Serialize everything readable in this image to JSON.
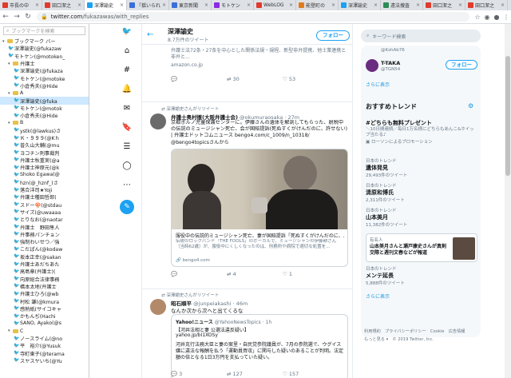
{
  "tabs": [
    {
      "label": "市長の中",
      "color": "#e03b2e"
    },
    {
      "label": "田口潔之",
      "color": "#e03b2e"
    },
    {
      "label": "深澤諭史",
      "color": "#1da1f2",
      "active": true
    },
    {
      "label": "『揺いられ",
      "color": "#3a6fd8"
    },
    {
      "label": "東京新聞",
      "color": "#3a6fd8"
    },
    {
      "label": "モトケン",
      "color": "#8a2be2"
    },
    {
      "label": "WebLOG",
      "color": "#e03b2e"
    },
    {
      "label": "能登町の",
      "color": "#e07b1d"
    },
    {
      "label": "深澤諭史",
      "color": "#1da1f2"
    },
    {
      "label": "遠法捜査",
      "color": "#2e8b57"
    },
    {
      "label": "田口潔之",
      "color": "#e03b2e"
    },
    {
      "label": "田口潔之",
      "color": "#e03b2e"
    }
  ],
  "address": {
    "host": "twitter.com",
    "path": "/fukazawas/with_replies"
  },
  "bookmarks": {
    "search_placeholder": "ブックマークを検索",
    "items": [
      {
        "label": "ブックマーク バー",
        "type": "folder",
        "exp": "▾",
        "indent": 0
      },
      {
        "label": "深澤諭史(@fukazaw",
        "type": "tw",
        "indent": 1
      },
      {
        "label": "モトケン(@motoken_",
        "type": "tw",
        "indent": 1
      },
      {
        "label": "弁護士",
        "type": "folder",
        "exp": "▾",
        "indent": 1
      },
      {
        "label": "深澤諭史(@fukaza",
        "type": "tw",
        "indent": 2
      },
      {
        "label": "モトケン(@motoke",
        "type": "tw",
        "indent": 2
      },
      {
        "label": "小倉秀夫(@Hide",
        "type": "tw",
        "indent": 2
      },
      {
        "label": "A",
        "type": "folder",
        "exp": "▾",
        "indent": 1
      },
      {
        "label": "深澤諭史(@fuka",
        "type": "tw",
        "indent": 2,
        "sel": true
      },
      {
        "label": "モトケン(@motok",
        "type": "tw",
        "indent": 2
      },
      {
        "label": "小倉秀夫(@Hide",
        "type": "tw",
        "indent": 2
      },
      {
        "label": "B",
        "type": "folder",
        "exp": "▾",
        "indent": 1
      },
      {
        "label": "ystk(@lawkus)さ",
        "type": "tw",
        "indent": 2
      },
      {
        "label": "Ｋ・９９９(@Kｈ",
        "type": "tw",
        "indent": 2
      },
      {
        "label": "普久山大輔(@mu",
        "type": "tw",
        "indent": 2
      },
      {
        "label": "ヨコチン刑事裁判",
        "type": "tw",
        "indent": 2
      },
      {
        "label": "弁護士秋重実(@a",
        "type": "tw",
        "indent": 2
      },
      {
        "label": "弁護士神原元(@k",
        "type": "tw",
        "indent": 2
      },
      {
        "label": "Shoko Egawa(@",
        "type": "tw",
        "indent": 2
      },
      {
        "label": "hzn(@_hznf_)さ",
        "type": "tw",
        "indent": 2
      },
      {
        "label": "落合洋司★Yoji",
        "type": "tw",
        "indent": 2
      },
      {
        "label": "弁護士種田哲郎(",
        "type": "tw",
        "indent": 2
      },
      {
        "label": "スドー🍄(@stdau",
        "type": "tw",
        "indent": 2
      },
      {
        "label": "サイズ(@uwaaaa",
        "type": "tw",
        "indent": 2
      },
      {
        "label": "とりなお(@naotar",
        "type": "tw",
        "indent": 2
      },
      {
        "label": "弁護士　野田隼人",
        "type": "tw",
        "indent": 2
      },
      {
        "label": "弁事務パンチョン",
        "type": "tw",
        "indent": 2
      },
      {
        "label": "強制わいせつ／強",
        "type": "tw",
        "indent": 2
      },
      {
        "label": "こだぱん(@kodaw",
        "type": "tw",
        "indent": 2
      },
      {
        "label": "坂本正幸(@sakan",
        "type": "tw",
        "indent": 2
      },
      {
        "label": "弁護士あだちあた",
        "type": "tw",
        "indent": 2
      },
      {
        "label": "高島章(弁護士)(",
        "type": "tw",
        "indent": 2
      },
      {
        "label": "向原総合法律事務",
        "type": "tw",
        "indent": 2
      },
      {
        "label": "橋本太地(弁護士",
        "type": "tw",
        "indent": 2
      },
      {
        "label": "弁護士ひろ(@wb",
        "type": "tw",
        "indent": 2
      },
      {
        "label": "村松 謙(@kmura",
        "type": "tw",
        "indent": 2
      },
      {
        "label": "感熱紙(サイコキャ",
        "type": "tw",
        "indent": 2
      },
      {
        "label": "かもんぢ(Hachi",
        "type": "tw",
        "indent": 2
      },
      {
        "label": "SANO, Ayako(@s",
        "type": "tw",
        "indent": 2
      },
      {
        "label": "C",
        "type": "folder",
        "exp": "▾",
        "indent": 1
      },
      {
        "label": "ノースライム(@no",
        "type": "tw",
        "indent": 2
      },
      {
        "label": "平　裕介(@Yusuk",
        "type": "tw",
        "indent": 2
      },
      {
        "label": "寺町東子(@terama",
        "type": "tw",
        "indent": 2
      },
      {
        "label": "スヤスヤいち(@Yu",
        "type": "tw",
        "indent": 2
      }
    ]
  },
  "leftnav": [
    "twitter-bird-icon",
    "home-icon",
    "hashtag-icon",
    "bell-icon",
    "mail-icon",
    "bookmark-icon",
    "list-icon",
    "profile-icon",
    "more-icon",
    "compose-icon"
  ],
  "header": {
    "name": "深澤諭史",
    "count": "8.7万件のツイート",
    "follow": "フォロー"
  },
  "tweet0": {
    "text": "弁護士法72条・27条を中心とした関係法規・規程、新型非弁提携、他士業連携と非弁と...",
    "domain": "amazon.co.jp",
    "reply": "",
    "rt": "30",
    "like": "53"
  },
  "tweet1": {
    "rt_label": "深澤諭史さんがリツイート",
    "name": "弁護士奥村徹(大阪弁護士会)",
    "handle": "@okumuraosaka · 27m",
    "text": "京都ポルノ児童保護センターに。伊藤さんの遺体を解剖してもらった、脱税中の伝説のミュージシャン死亡、会が国賠提訴(死ぬすくがけんだのに、許せない) | 弁護士ドットコムニュース bengo4.com/c_1009/n_10318/ @bengo4topicsさんから",
    "card_title": "服役中の伝説的ミュージシャン死亡、妻が国賠提訴「死ぬすくがけんだのに、...",
    "card_desc": "伝説のロックバンド「THE FOOLS」のボーカルで、ミュージシャンの伊藤耕さん（当時62歳）が、服役中にくしくなったのは、刑務所や病院で適切な処置を...",
    "card_domain": "bengo4.com",
    "reply": "",
    "rt": "4",
    "like": "1"
  },
  "tweet2": {
    "rt_label": "深澤諭史さんがリツイート",
    "name": "昭石順平",
    "handle": "@junpeiakashi · 46m",
    "text": "なんか次から次へと出てくるな",
    "quote_name": "Yahoo!ニュース",
    "quote_handle": "@YahooNewsTopics · 1h",
    "quote_text1": "【河井法相と妻 公選法違反疑い】",
    "quote_link": "yahoo.jp/bI1XOSy",
    "quote_text2": "河井克行法務大臣と妻の案里・自民党参院議員が、7月の参院選で、ウグイス嬢に違法な報酬を払う「運動員買収」に関与した疑いのあることが判明。法定額の倍となる1日3万円を支払っていた疑い。",
    "reply": "3",
    "rt": "127",
    "like": "157"
  },
  "right": {
    "search_placeholder": "キーワード検索",
    "suggest1_handle": "@KshAb76",
    "suggest2_name": "T-TAKA",
    "suggest2_handle": "@TGN54",
    "follow": "フォロー",
    "more": "さらに表示",
    "trends_title": "おすすめトレンド",
    "trends": [
      {
        "meta": "",
        "name": "#どちらも無料プレゼント",
        "sub": "＼10日間連続／毎日1万名様にどちらもあんこ&ホイップ当たる♪",
        "promo": "ローソンによるプロモーション"
      },
      {
        "meta": "日本のトレンド",
        "name": "遺体発見",
        "count": "29,493件のツイート"
      },
      {
        "meta": "日本のトレンド",
        "name": "清原和博氏",
        "count": "2,311件のツイート"
      },
      {
        "meta": "日本のトレンド",
        "name": "山本美月",
        "count": "11,382件のツイート"
      }
    ],
    "news_name": "有名人",
    "news_text": "山本美月さんと瀬戸康史さんが真剣交際と週刊文春などが報道",
    "trend5": {
      "meta": "日本のトレンド",
      "name": "メンテ延長",
      "count": "5,888件のツイート"
    },
    "footer1": "利用規約　プライバシーポリシー　Cookie　広告情報",
    "footer2": "もっと見る ▾　© 2019 Twitter, Inc."
  }
}
